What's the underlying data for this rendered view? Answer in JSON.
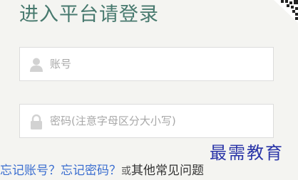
{
  "login": {
    "title": "进入平台请登录",
    "account_placeholder": "账号",
    "password_placeholder": "密码(注意字母区分大小写)",
    "account_icon": "user-icon",
    "password_icon": "lock-icon",
    "forgot_account": "忘记账号？",
    "forgot_password": "忘记密码？",
    "or_text": "或",
    "faq": "其他常见问题"
  },
  "watermark": "最需教育",
  "colors": {
    "title": "#47796e",
    "link": "#3b6ed0",
    "background": "#f4f4f1",
    "watermark": "#2a35a8"
  }
}
